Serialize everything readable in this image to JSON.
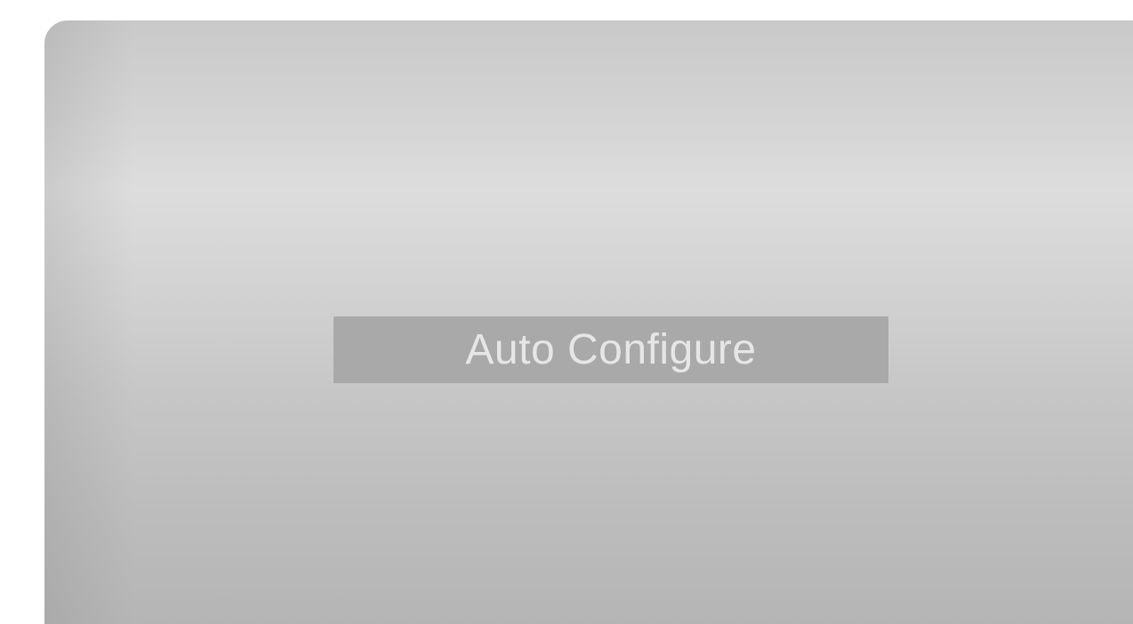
{
  "osd": {
    "message": "Auto Configure"
  },
  "colors": {
    "box_background": "#a9a9a9",
    "text": "#e6e6e6"
  }
}
